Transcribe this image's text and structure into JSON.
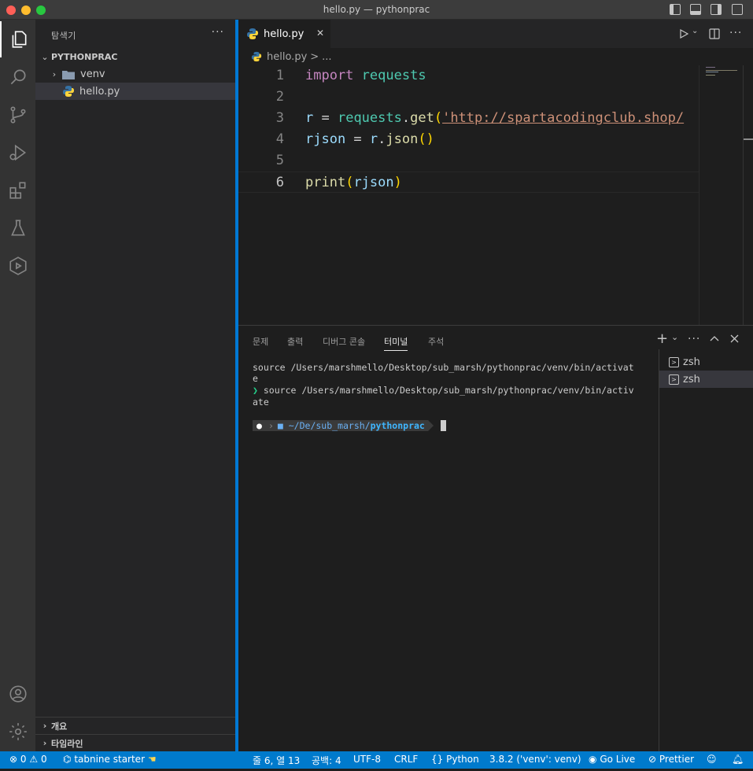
{
  "window": {
    "title": "hello.py — pythonprac"
  },
  "sidebar": {
    "title": "탐색기",
    "more": "···",
    "folder": "PYTHONPRAC",
    "items": [
      {
        "label": "venv"
      },
      {
        "label": "hello.py"
      }
    ],
    "sections": [
      "개요",
      "타임라인"
    ]
  },
  "editor": {
    "tab": {
      "label": "hello.py",
      "close": "✕"
    },
    "breadcrumb": {
      "file": "hello.py",
      "sep": ">",
      "more": "..."
    },
    "lines": [
      {
        "num": "1",
        "tokens": [
          [
            "kw",
            "import"
          ],
          [
            "op",
            " "
          ],
          [
            "mod",
            "requests"
          ]
        ]
      },
      {
        "num": "2",
        "tokens": []
      },
      {
        "num": "3",
        "tokens": [
          [
            "var",
            "r"
          ],
          [
            "op",
            " = "
          ],
          [
            "mod",
            "requests"
          ],
          [
            "op",
            "."
          ],
          [
            "fn",
            "get"
          ],
          [
            "br1",
            "("
          ],
          [
            "str",
            "'http://spartacodingclub.shop/"
          ]
        ]
      },
      {
        "num": "4",
        "tokens": [
          [
            "var",
            "rjson"
          ],
          [
            "op",
            " = "
          ],
          [
            "var",
            "r"
          ],
          [
            "op",
            "."
          ],
          [
            "fn",
            "json"
          ],
          [
            "br1",
            "()"
          ]
        ]
      },
      {
        "num": "5",
        "tokens": []
      },
      {
        "num": "6",
        "tokens": [
          [
            "fn",
            "print"
          ],
          [
            "br1",
            "("
          ],
          [
            "var",
            "rjson"
          ],
          [
            "br1",
            ")"
          ]
        ]
      }
    ]
  },
  "panel": {
    "tabs": [
      "문제",
      "출력",
      "디버그 콘솔",
      "터미널",
      "주석"
    ],
    "active_tab": 3,
    "terminal_lines": [
      "source /Users/marshmello/Desktop/sub_marsh/pythonprac/venv/bin/activat",
      "e",
      "source /Users/marshmello/Desktop/sub_marsh/pythonprac/venv/bin/activ",
      "ate"
    ],
    "prompt_marker": "❯",
    "prompt_path": "~/De/sub_marsh/",
    "prompt_dir": "pythonprac",
    "terminals": [
      "zsh",
      "zsh"
    ],
    "plus": "+",
    "chevron": "⌄",
    "more": "···"
  },
  "status": {
    "errors": "0",
    "warnings": "0",
    "tabnine": "tabnine starter",
    "position": "줄 6, 열 13",
    "spaces": "공백: 4",
    "encoding": "UTF-8",
    "eol": "CRLF",
    "language": "Python",
    "interpreter": "3.8.2 ('venv': venv)",
    "golive": "Go Live",
    "prettier": "Prettier"
  },
  "colors": {
    "statusbar": "#007acc",
    "accent": "#0078d4"
  }
}
